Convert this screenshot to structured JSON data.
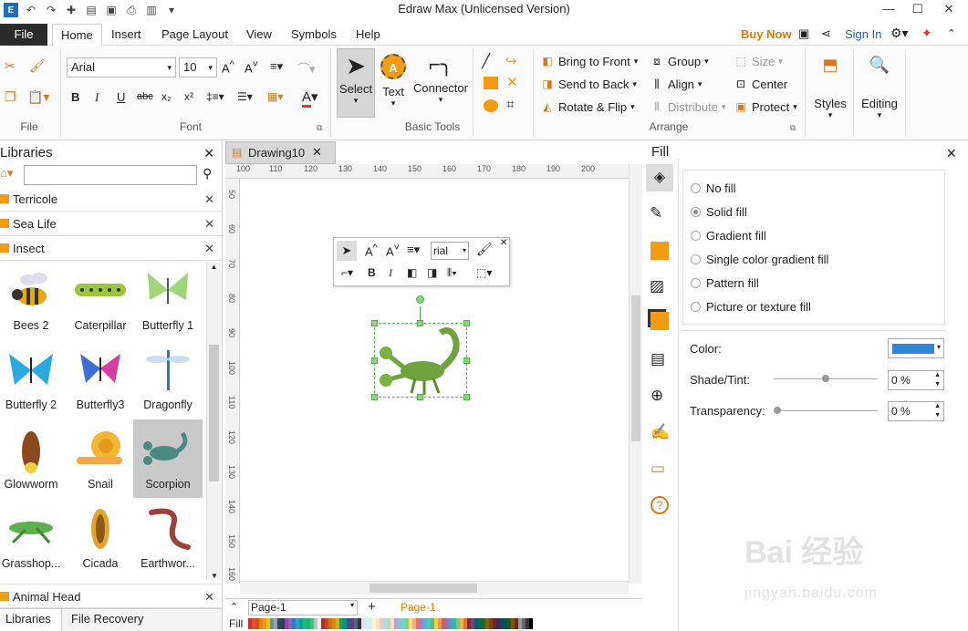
{
  "window": {
    "title": "Edraw Max (Unlicensed Version)"
  },
  "menu": {
    "tabs": [
      "File",
      "Home",
      "Insert",
      "Page Layout",
      "View",
      "Symbols",
      "Help"
    ],
    "active": "Home",
    "buy_now": "Buy Now",
    "sign_in": "Sign In"
  },
  "ribbon": {
    "file_group": "File",
    "font_group": "Font",
    "font_name": "Arial",
    "font_size": "10",
    "basic_tools_group": "Basic Tools",
    "select": "Select",
    "text": "Text",
    "connector": "Connector",
    "arrange_group": "Arrange",
    "bring_to_front": "Bring to Front",
    "send_to_back": "Send to Back",
    "rotate_flip": "Rotate & Flip",
    "group": "Group",
    "align": "Align",
    "distribute": "Distribute",
    "size": "Size",
    "center": "Center",
    "protect": "Protect",
    "styles": "Styles",
    "editing": "Editing"
  },
  "libraries": {
    "title": "Libraries",
    "search_placeholder": "",
    "categories": [
      "Terricole",
      "Sea Life",
      "Insect"
    ],
    "items": [
      {
        "label": "Bees 2",
        "icon": "bee-icon"
      },
      {
        "label": "Caterpillar",
        "icon": "caterpillar-icon"
      },
      {
        "label": "Butterfly 1",
        "icon": "butterfly-green-icon"
      },
      {
        "label": "Butterfly 2",
        "icon": "butterfly-blue-icon"
      },
      {
        "label": "Butterfly3",
        "icon": "butterfly-multi-icon"
      },
      {
        "label": "Dragonfly",
        "icon": "dragonfly-icon"
      },
      {
        "label": "Glowworm",
        "icon": "glowworm-icon"
      },
      {
        "label": "Snail",
        "icon": "snail-icon"
      },
      {
        "label": "Scorpion",
        "icon": "scorpion-icon"
      },
      {
        "label": "Grasshop...",
        "icon": "grasshopper-icon"
      },
      {
        "label": "Cicada",
        "icon": "cicada-icon"
      },
      {
        "label": "Earthwor...",
        "icon": "earthworm-icon"
      }
    ],
    "bottom_category": "Animal Head",
    "bottom_tabs": [
      "Libraries",
      "File Recovery"
    ]
  },
  "document": {
    "tab": "Drawing10",
    "ruler_top": [
      "100",
      "110",
      "120",
      "130",
      "140",
      "150",
      "160",
      "170",
      "180",
      "190",
      "200"
    ],
    "ruler_left": [
      "50",
      "60",
      "70",
      "80",
      "90",
      "100",
      "110",
      "120",
      "130",
      "140",
      "150",
      "160"
    ],
    "mini_toolbar_font": "rial",
    "page_select": "Page-1",
    "page_tab": "Page-1",
    "fill_label": "Fill"
  },
  "fill_panel": {
    "title": "Fill",
    "options": [
      "No fill",
      "Solid fill",
      "Gradient fill",
      "Single color gradient fill",
      "Pattern fill",
      "Picture or texture fill"
    ],
    "selected": "Solid fill",
    "color_label": "Color:",
    "color_value": "#2e86d4",
    "shade_label": "Shade/Tint:",
    "shade_value": "0 %",
    "transparency_label": "Transparency:",
    "transparency_value": "0 %"
  },
  "colors": {
    "accent": "#e07b00",
    "selection": "#4caf50",
    "file_tab": "#2b2b2b"
  }
}
